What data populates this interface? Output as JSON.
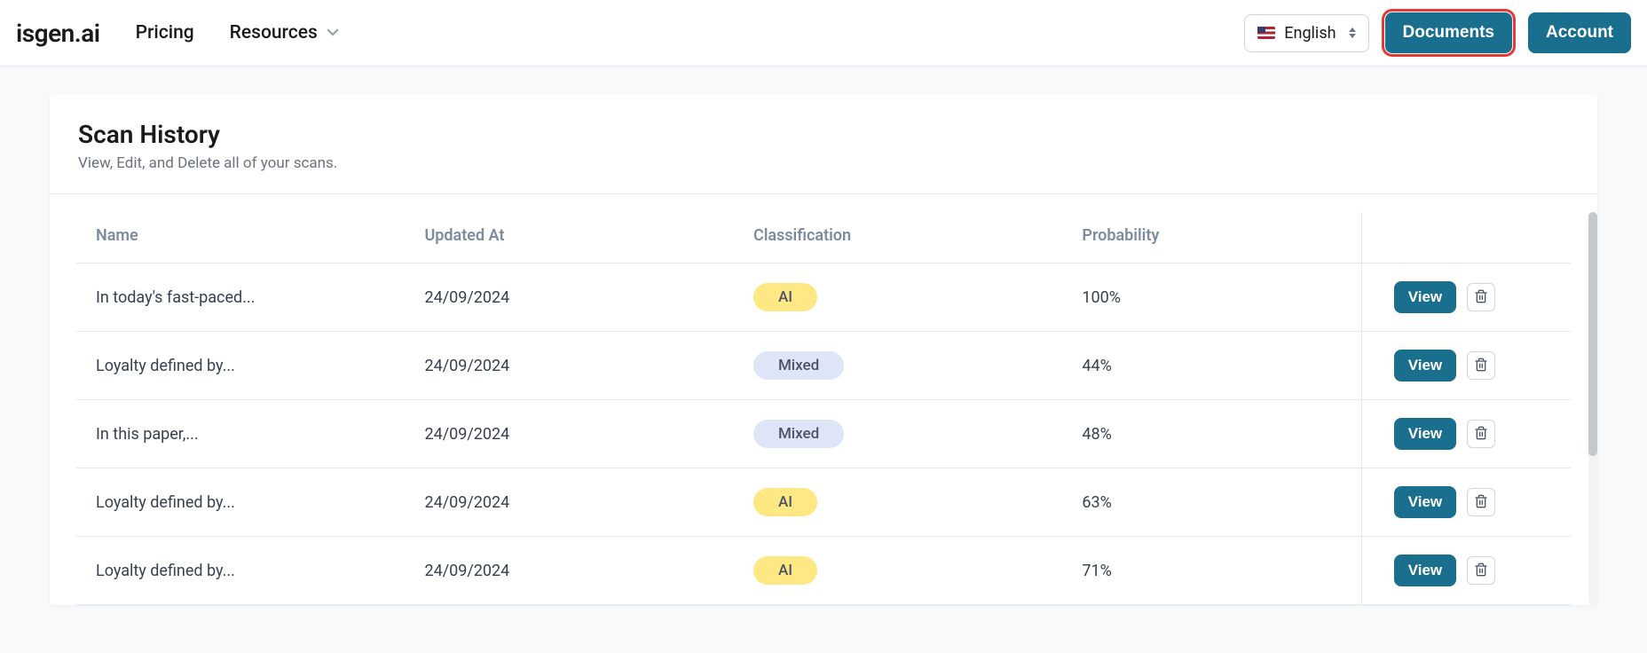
{
  "brand": "isgen.ai",
  "nav": {
    "pricing": "Pricing",
    "resources": "Resources"
  },
  "lang": {
    "label": "English"
  },
  "buttons": {
    "documents": "Documents",
    "account": "Account",
    "view": "View"
  },
  "page": {
    "title": "Scan History",
    "subtitle": "View, Edit, and Delete all of your scans."
  },
  "table": {
    "headers": {
      "name": "Name",
      "updated": "Updated At",
      "classification": "Classification",
      "probability": "Probability"
    },
    "rows": [
      {
        "name": "In today's fast-paced...",
        "updated": "24/09/2024",
        "classification": "AI",
        "classType": "ai",
        "probability": "100%"
      },
      {
        "name": "Loyalty defined by...",
        "updated": "24/09/2024",
        "classification": "Mixed",
        "classType": "mixed",
        "probability": "44%"
      },
      {
        "name": "In this paper,...",
        "updated": "24/09/2024",
        "classification": "Mixed",
        "classType": "mixed",
        "probability": "48%"
      },
      {
        "name": "Loyalty defined by...",
        "updated": "24/09/2024",
        "classification": "AI",
        "classType": "ai",
        "probability": "63%"
      },
      {
        "name": "Loyalty defined by...",
        "updated": "24/09/2024",
        "classification": "AI",
        "classType": "ai",
        "probability": "71%"
      }
    ]
  }
}
